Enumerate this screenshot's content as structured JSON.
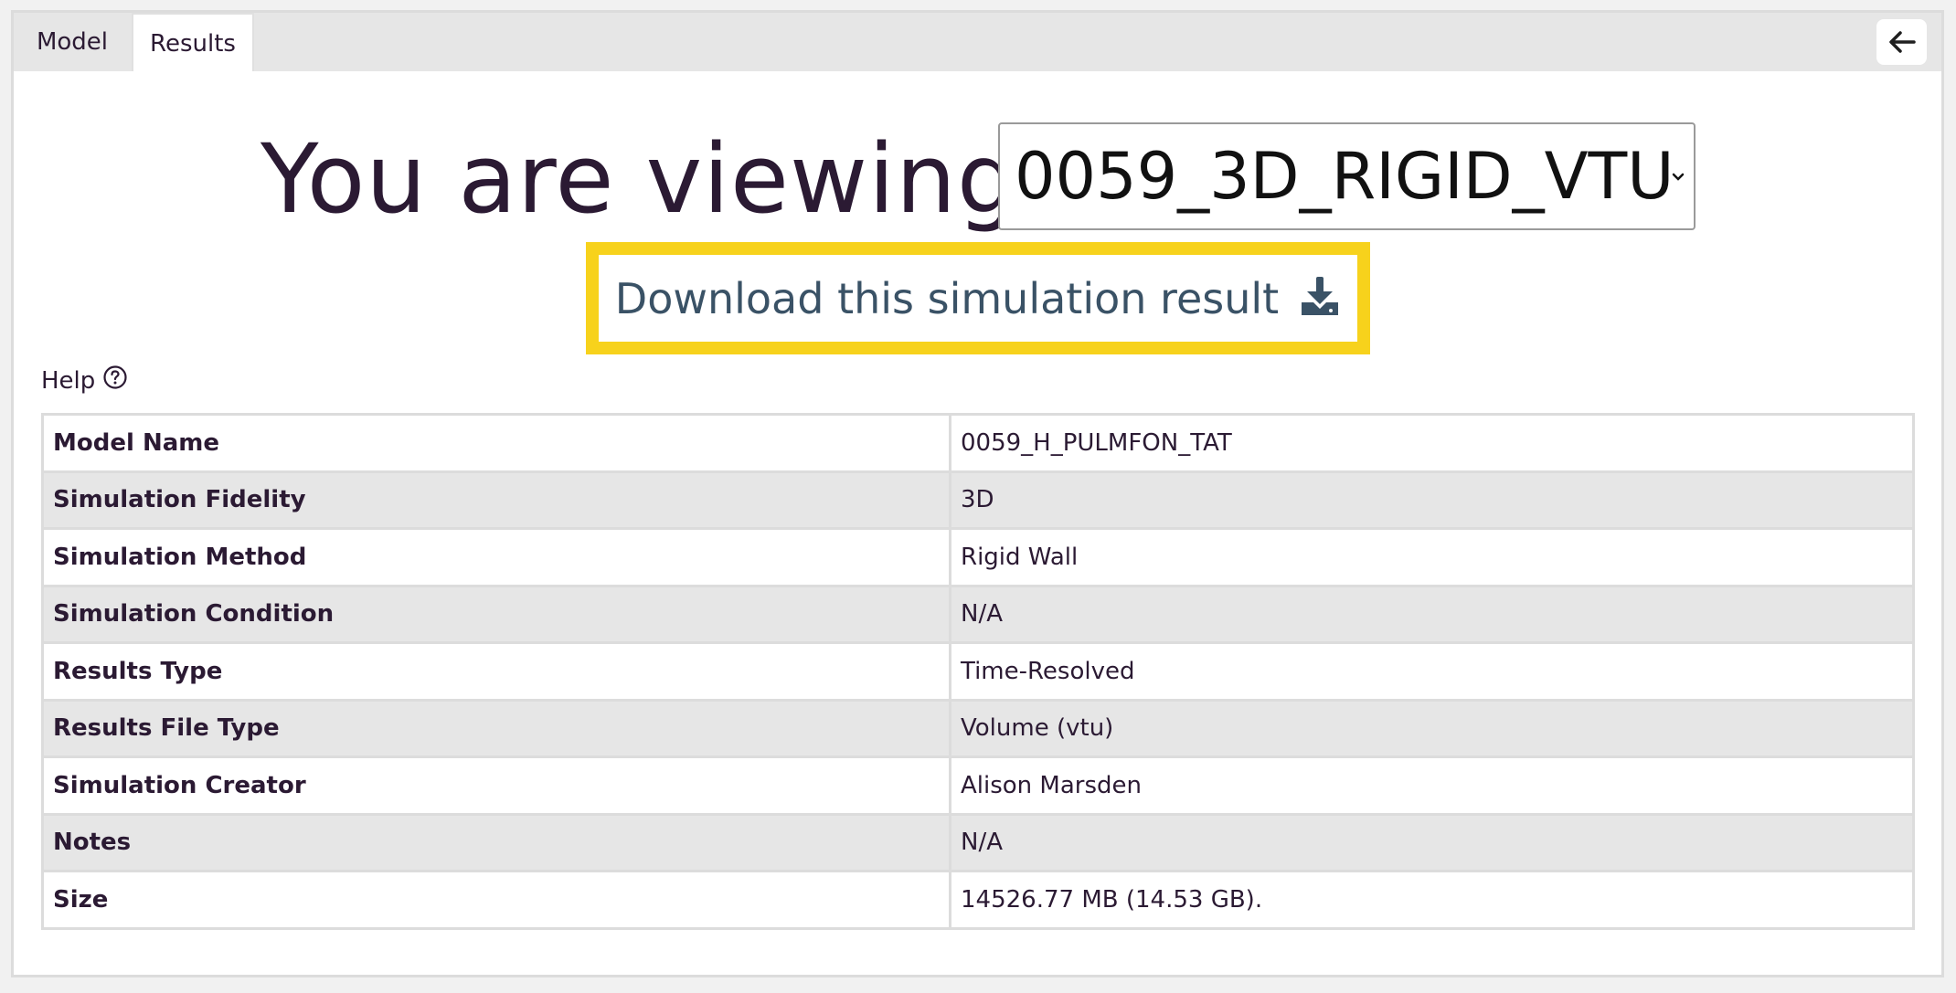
{
  "tabs": [
    {
      "label": "Model"
    },
    {
      "label": "Results"
    }
  ],
  "back_button_icon": "arrow-left-icon",
  "heading": "You are viewing",
  "simulation_select": {
    "selected": "0059_3D_RIGID_VTU"
  },
  "download": {
    "label": "Download this simulation result",
    "icon": "download-icon",
    "highlight_color": "#f7d21c"
  },
  "help": {
    "label": "Help",
    "icon": "question-circle-icon"
  },
  "details": [
    {
      "key": "Model Name",
      "value": "0059_H_PULMFON_TAT"
    },
    {
      "key": "Simulation Fidelity",
      "value": "3D"
    },
    {
      "key": "Simulation Method",
      "value": "Rigid Wall"
    },
    {
      "key": "Simulation Condition",
      "value": "N/A"
    },
    {
      "key": "Results Type",
      "value": "Time-Resolved"
    },
    {
      "key": "Results File Type",
      "value": "Volume (vtu)"
    },
    {
      "key": "Simulation Creator",
      "value": "Alison Marsden"
    },
    {
      "key": "Notes",
      "value": "N/A"
    },
    {
      "key": "Size",
      "value": "14526.77 MB (14.53 GB)."
    }
  ]
}
